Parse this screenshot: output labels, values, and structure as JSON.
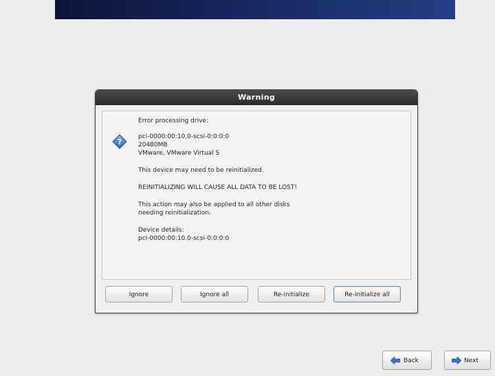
{
  "dialog": {
    "title": "Warning",
    "message": {
      "heading": "Error processing drive:",
      "device_lines": [
        "pci-0000:00:10.0-scsi-0:0:0:0",
        "20480MB",
        "VMware, VMware Virtual S"
      ],
      "reinit_note": "This device may need to be reinitialized.",
      "data_warning": "REINITIALIZING WILL CAUSE ALL DATA TO BE LOST!",
      "apply_note_lines": [
        "This action may also be applied to all other disks",
        "needing reinitialization."
      ],
      "details_label": "Device details:",
      "details_value": "pci-0000:00:10.0-scsi-0:0:0:0"
    },
    "buttons": {
      "ignore": "Ignore",
      "ignore_all": "Ignore all",
      "reinitialize": "Re-initialize",
      "reinitialize_all": "Re-initialize all"
    }
  },
  "footer": {
    "back_label": "Back",
    "next_label": "Next"
  },
  "icons": {
    "dialog_icon": "question-icon",
    "back_icon": "arrow-left-icon",
    "next_icon": "arrow-right-icon"
  },
  "colors": {
    "banner": "#1a2a66",
    "titlebar": "#2f2f2f",
    "background": "#ededeb"
  }
}
